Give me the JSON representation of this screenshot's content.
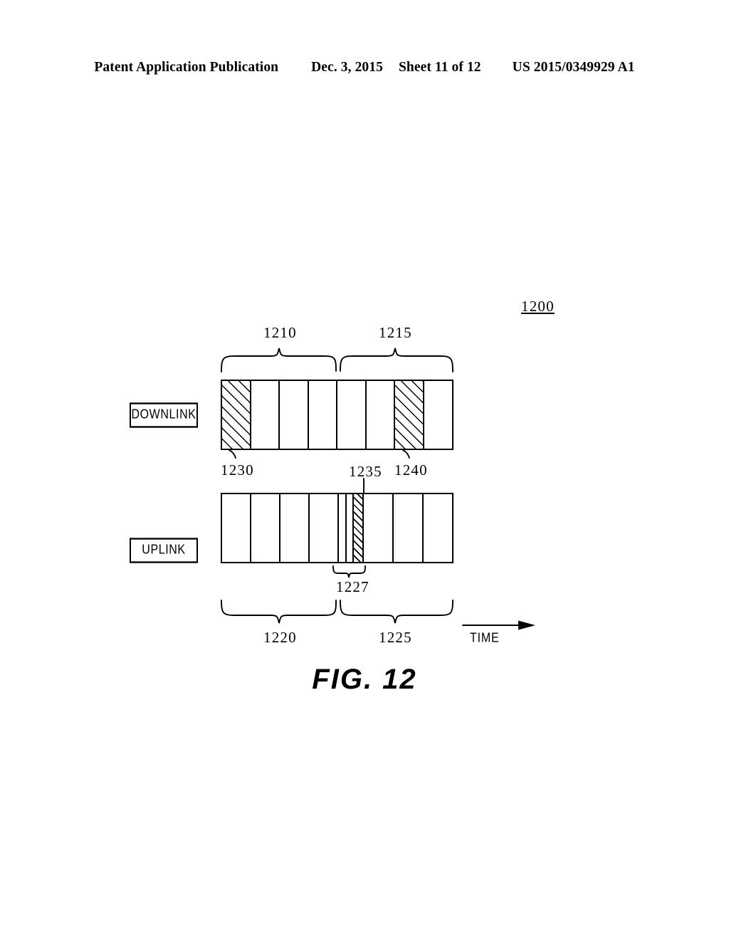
{
  "header": {
    "publication": "Patent Application Publication",
    "date": "Dec. 3, 2015",
    "sheet": "Sheet 11 of 12",
    "patent_number": "US 2015/0349929 A1"
  },
  "figure": {
    "caption": "FIG.  12",
    "figure_ref": "1200",
    "time_axis_label": "TIME",
    "row_labels": {
      "downlink": "DOWNLINK",
      "uplink": "UPLINK"
    },
    "references": {
      "downlink_first_half": "1210",
      "downlink_second_half": "1215",
      "downlink_first_slot": "1230",
      "uplink_narrow_slot": "1235",
      "downlink_hatched_slot": "1240",
      "uplink_first_half": "1220",
      "uplink_second_half": "1225",
      "uplink_narrow_group": "1227"
    }
  },
  "chart_data": {
    "type": "diagram",
    "title": "FIG. 12 - Downlink / Uplink frame structure over time",
    "x_axis": "TIME",
    "rows": [
      {
        "name": "DOWNLINK",
        "label": "DOWNLINK",
        "ref_first_half": "1210",
        "ref_second_half": "1215",
        "slot_count": 8,
        "slots": [
          {
            "index": 0,
            "fill": "hatched",
            "ref": "1230",
            "width_units": 1
          },
          {
            "index": 1,
            "fill": "empty",
            "ref": null,
            "width_units": 1
          },
          {
            "index": 2,
            "fill": "empty",
            "ref": null,
            "width_units": 1
          },
          {
            "index": 3,
            "fill": "empty",
            "ref": null,
            "width_units": 1
          },
          {
            "index": 4,
            "fill": "empty",
            "ref": null,
            "width_units": 1
          },
          {
            "index": 5,
            "fill": "empty",
            "ref": null,
            "width_units": 1
          },
          {
            "index": 6,
            "fill": "hatched",
            "ref": "1240",
            "width_units": 1
          },
          {
            "index": 7,
            "fill": "empty",
            "ref": null,
            "width_units": 1
          }
        ]
      },
      {
        "name": "UPLINK",
        "label": "UPLINK",
        "ref_first_half": "1220",
        "ref_second_half": "1225",
        "slot_count": 10,
        "narrow_group_ref": "1227",
        "slots": [
          {
            "index": 0,
            "fill": "empty",
            "ref": null,
            "width_units": 1
          },
          {
            "index": 1,
            "fill": "empty",
            "ref": null,
            "width_units": 1
          },
          {
            "index": 2,
            "fill": "empty",
            "ref": null,
            "width_units": 1
          },
          {
            "index": 3,
            "fill": "empty",
            "ref": null,
            "width_units": 1
          },
          {
            "index": 4,
            "fill": "empty",
            "ref": null,
            "width_units": 0.25
          },
          {
            "index": 5,
            "fill": "empty",
            "ref": null,
            "width_units": 0.2
          },
          {
            "index": 6,
            "fill": "hatched",
            "ref": "1235",
            "width_units": 0.25
          },
          {
            "index": 7,
            "fill": "empty",
            "ref": null,
            "width_units": 1
          },
          {
            "index": 8,
            "fill": "empty",
            "ref": null,
            "width_units": 1
          },
          {
            "index": 9,
            "fill": "empty",
            "ref": null,
            "width_units": 1
          }
        ]
      }
    ],
    "braces": [
      {
        "ref": "1210",
        "row": "DOWNLINK",
        "position": "above",
        "span": "slots 0-3"
      },
      {
        "ref": "1215",
        "row": "DOWNLINK",
        "position": "above",
        "span": "slots 4-7"
      },
      {
        "ref": "1227",
        "row": "UPLINK",
        "position": "below",
        "span": "narrow slots 4-6"
      },
      {
        "ref": "1220",
        "row": "UPLINK",
        "position": "below",
        "span": "left half"
      },
      {
        "ref": "1225",
        "row": "UPLINK",
        "position": "below",
        "span": "right half"
      }
    ]
  }
}
